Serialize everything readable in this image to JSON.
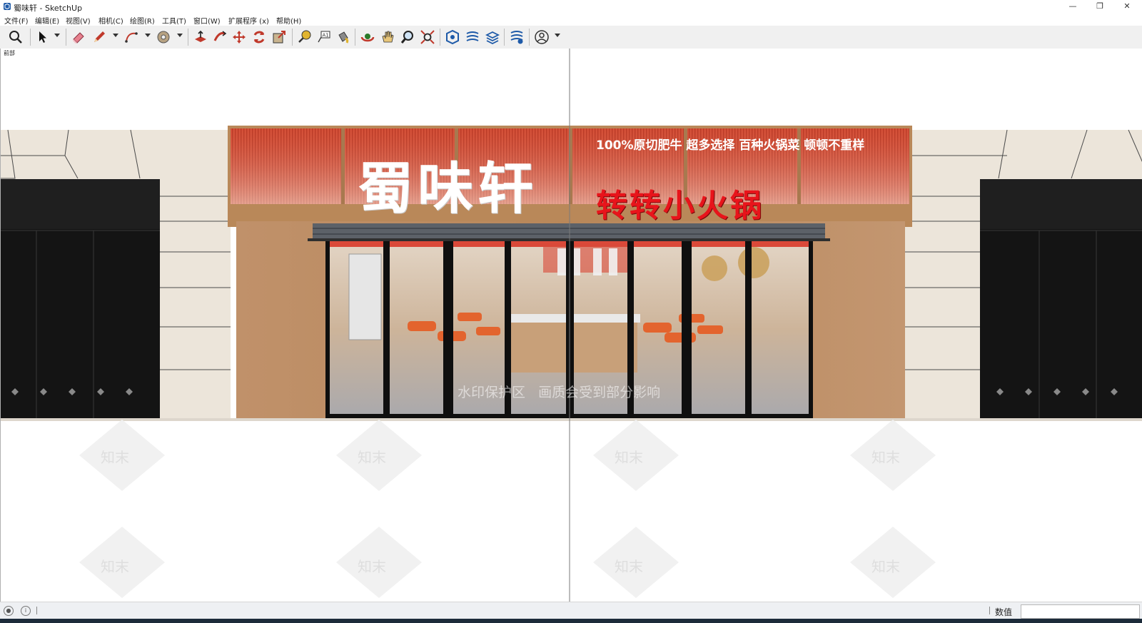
{
  "window": {
    "title": "蜀味轩 - SketchUp",
    "controls": {
      "minimize": "—",
      "restore": "❐",
      "close": "✕"
    }
  },
  "menu": [
    "文件(F)",
    "编辑(E)",
    "视图(V)",
    "相机(C)",
    "绘图(R)",
    "工具(T)",
    "窗口(W)",
    "扩展程序 (x)",
    "帮助(H)"
  ],
  "toolbar": {
    "tools": [
      "search-icon",
      "select-icon",
      "eraser-icon",
      "pencil-icon",
      "arc-icon",
      "shape-icon",
      "push-pull-icon",
      "follow-me-icon",
      "move-icon",
      "rotate-icon",
      "scale-icon",
      "tape-measure-icon",
      "text-icon",
      "paint-bucket-icon",
      "orbit-icon",
      "pan-icon",
      "zoom-icon",
      "zoom-extents-icon",
      "warehouse-icon",
      "extension-warehouse-icon",
      "layout-icon",
      "extension-manager-icon",
      "account-icon"
    ]
  },
  "scene": {
    "tab_label": "前部",
    "brand_name": "蜀味轩",
    "slogan": "100%原切肥牛  超多选择  百种火锅菜  顿顿不重样",
    "subtitle": "转转小火锅",
    "watermark_text": "水印保护区   画质会受到部分影响",
    "watermark_brand": "知末",
    "colors": {
      "sign_red": "#d54a32",
      "wood": "#b98859",
      "stone": "#ece5da",
      "dark_panel": "#141414",
      "red_text": "#e8141b"
    }
  },
  "status": {
    "measurements_label": "数值",
    "measurements_value": ""
  }
}
